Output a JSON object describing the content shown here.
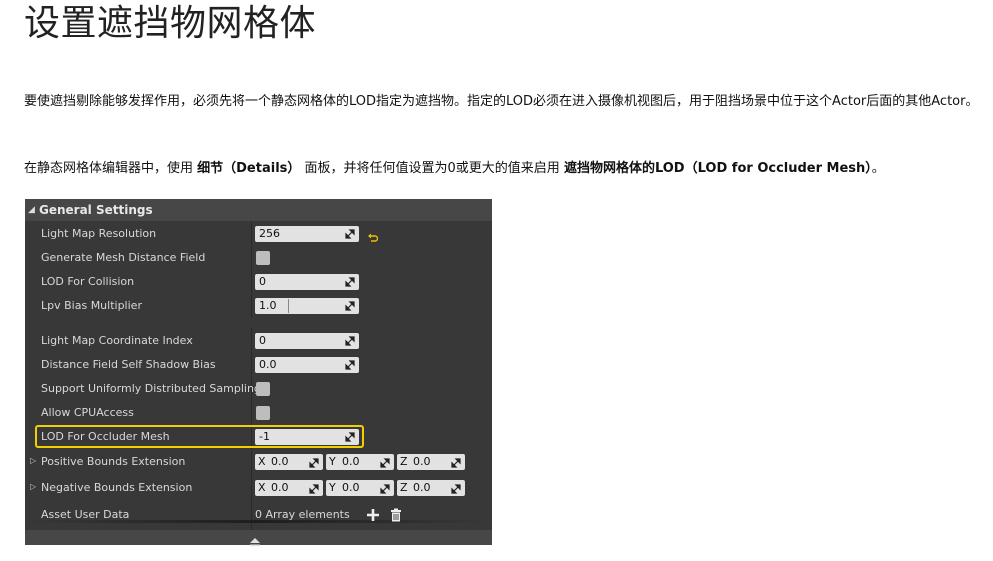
{
  "page": {
    "title": "设置遮挡物网格体",
    "para1": "要使遮挡剔除能够发挥作用，必须先将一个静态网格体的LOD指定为遮挡物。指定的LOD必须在进入摄像机视图后，用于阻挡场景中位于这个Actor后面的其他Actor。",
    "para2_pre": "在静态网格体编辑器中，使用 ",
    "para2_b1": "细节（Details）",
    "para2_mid": " 面板，并将任何值设置为0或更大的值来启用 ",
    "para2_b2": "遮挡物网格体的LOD（LOD for Occluder Mesh）",
    "para2_post": "。"
  },
  "panel": {
    "header": "General Settings",
    "rows": {
      "light_map_resolution": {
        "label": "Light Map Resolution",
        "value": "256"
      },
      "generate_mesh_distance_field": {
        "label": "Generate Mesh Distance Field"
      },
      "lod_for_collision": {
        "label": "LOD For Collision",
        "value": "0"
      },
      "lpv_bias_multiplier": {
        "label": "Lpv Bias Multiplier",
        "value": "1.0"
      },
      "light_map_coordinate_index": {
        "label": "Light Map Coordinate Index",
        "value": "0"
      },
      "distance_field_self_shadow_bias": {
        "label": "Distance Field Self Shadow Bias",
        "value": "0.0"
      },
      "support_uniformly_distributed_sampling": {
        "label": "Support Uniformly Distributed Sampling"
      },
      "allow_cpu_access": {
        "label": "Allow CPUAccess"
      },
      "lod_for_occluder_mesh": {
        "label": "LOD For Occluder Mesh",
        "value": "-1"
      },
      "positive_bounds_extension": {
        "label": "Positive Bounds Extension",
        "x": "0.0",
        "y": "0.0",
        "z": "0.0"
      },
      "negative_bounds_extension": {
        "label": "Negative Bounds Extension",
        "x": "0.0",
        "y": "0.0",
        "z": "0.0"
      },
      "asset_user_data": {
        "label": "Asset User Data",
        "value": "0 Array elements"
      }
    },
    "axis": {
      "x": "X",
      "y": "Y",
      "z": "Z"
    },
    "colors": {
      "highlight": "#f0d000",
      "panel_bg": "#383838",
      "header_bg": "#474747"
    }
  }
}
